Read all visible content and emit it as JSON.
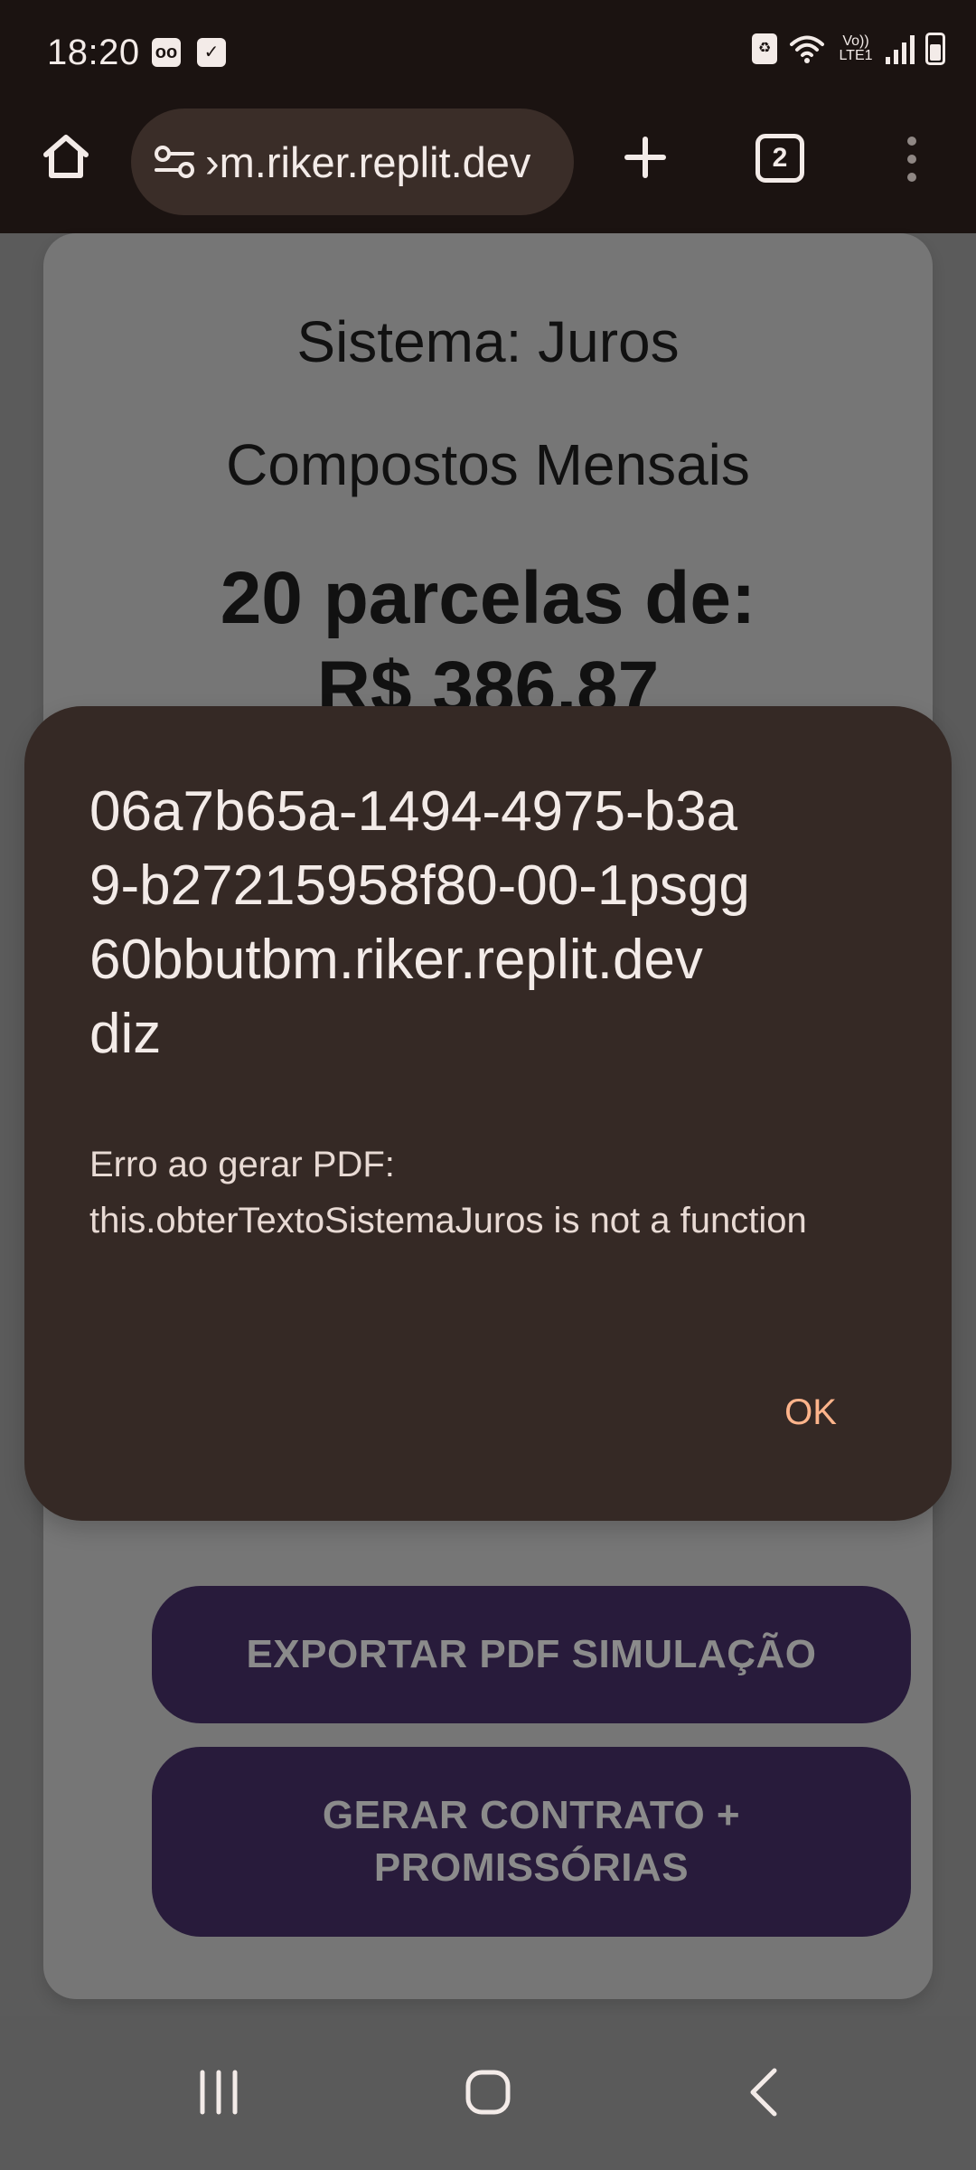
{
  "status_bar": {
    "time": "18:20",
    "lte": "Vo))\nLTE1"
  },
  "browser": {
    "address": "›m.riker.replit.dev",
    "tab_count": "2"
  },
  "page": {
    "sistema": "Sistema: Juros\nCompostos Mensais",
    "parcelas": "20 parcelas de:",
    "hidden_price": "R$ 386,87",
    "export_button": "EXPORTAR PDF SIMULAÇÃO",
    "contract_button": "GERAR CONTRATO +\nPROMISSÓRIAS"
  },
  "dialog": {
    "title": "06a7b65a-1494-4975-b3a\n9-b27215958f80-00-1psgg\n60bbutbm.riker.replit.dev\ndiz",
    "message": "Erro ao gerar PDF:\nthis.obterTextoSistemaJuros is not a function",
    "ok_label": "OK"
  },
  "icons": {
    "status_icons": [
      "voicemail-icon",
      "checkbox-icon",
      "recycle-icon",
      "wifi-icon",
      "signal-icon",
      "battery-icon"
    ],
    "browser_icons": [
      "home-icon",
      "tune-icon",
      "plus-icon",
      "more-vertical-icon"
    ],
    "nav_icons": [
      "recent-apps-icon",
      "home-circle-icon",
      "back-icon"
    ]
  },
  "colors": {
    "status_background": "#1b1311",
    "address_pill": "#3a2d28",
    "dialog_background": "#352925",
    "dialog_accent": "#ffb48b",
    "page_button": "#281b3b"
  }
}
